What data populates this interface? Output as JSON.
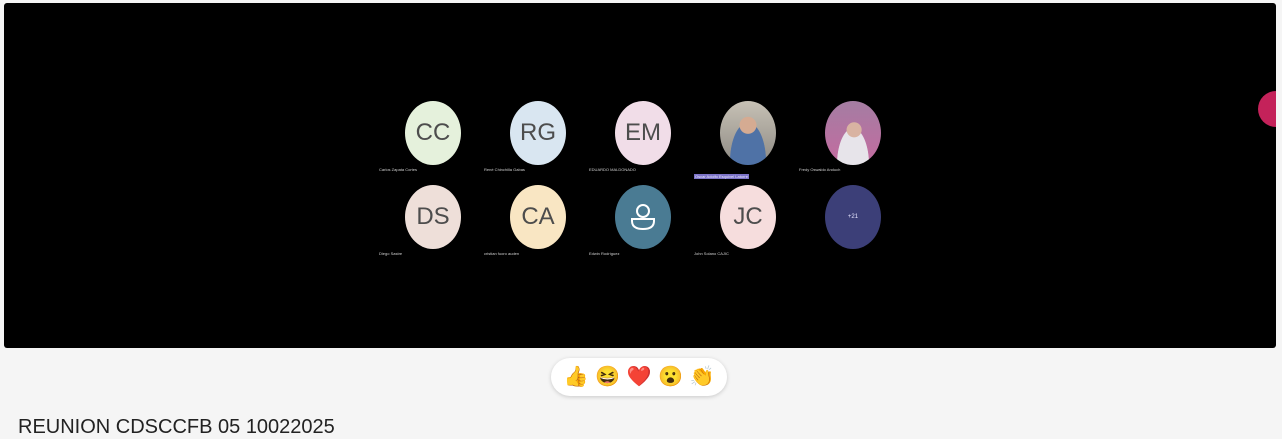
{
  "participants": [
    {
      "initials": "CC",
      "name": "Carlos Zapata Cortes",
      "bg": "#e5f1dc"
    },
    {
      "initials": "RG",
      "name": "René Chinchilla Gabas",
      "bg": "#d9e6f1"
    },
    {
      "initials": "EM",
      "name": "EDUARDO MALDONADO",
      "bg": "#f1dde8"
    },
    {
      "initials": "",
      "name": "Oscar Adolfo Esquivel Latorre",
      "photo": "photo1"
    },
    {
      "initials": "",
      "name": "Fredy Oswaldo Anduch",
      "photo": "photo2"
    },
    {
      "initials": "DS",
      "name": "Diego Sastre",
      "bg": "#eedfd9"
    },
    {
      "initials": "CA",
      "name": "cristian fuoro auden",
      "bg": "#f9e6c3"
    },
    {
      "initials": "",
      "name": "Edwin Rodríguez",
      "generic": true
    },
    {
      "initials": "JC",
      "name": "John Solano CAJIC",
      "bg": "#f6dddd"
    },
    {
      "initials": "+21",
      "name": "",
      "overflow": true
    }
  ],
  "reactions": [
    {
      "emoji": "👍",
      "label": "like"
    },
    {
      "emoji": "😆",
      "label": "laugh"
    },
    {
      "emoji": "❤️",
      "label": "heart"
    },
    {
      "emoji": "😮",
      "label": "surprised"
    },
    {
      "emoji": "👏",
      "label": "applause"
    }
  ],
  "meeting": {
    "title": "REUNION CDSCCFB 05 10022025"
  },
  "accent_color": "#c4225a"
}
